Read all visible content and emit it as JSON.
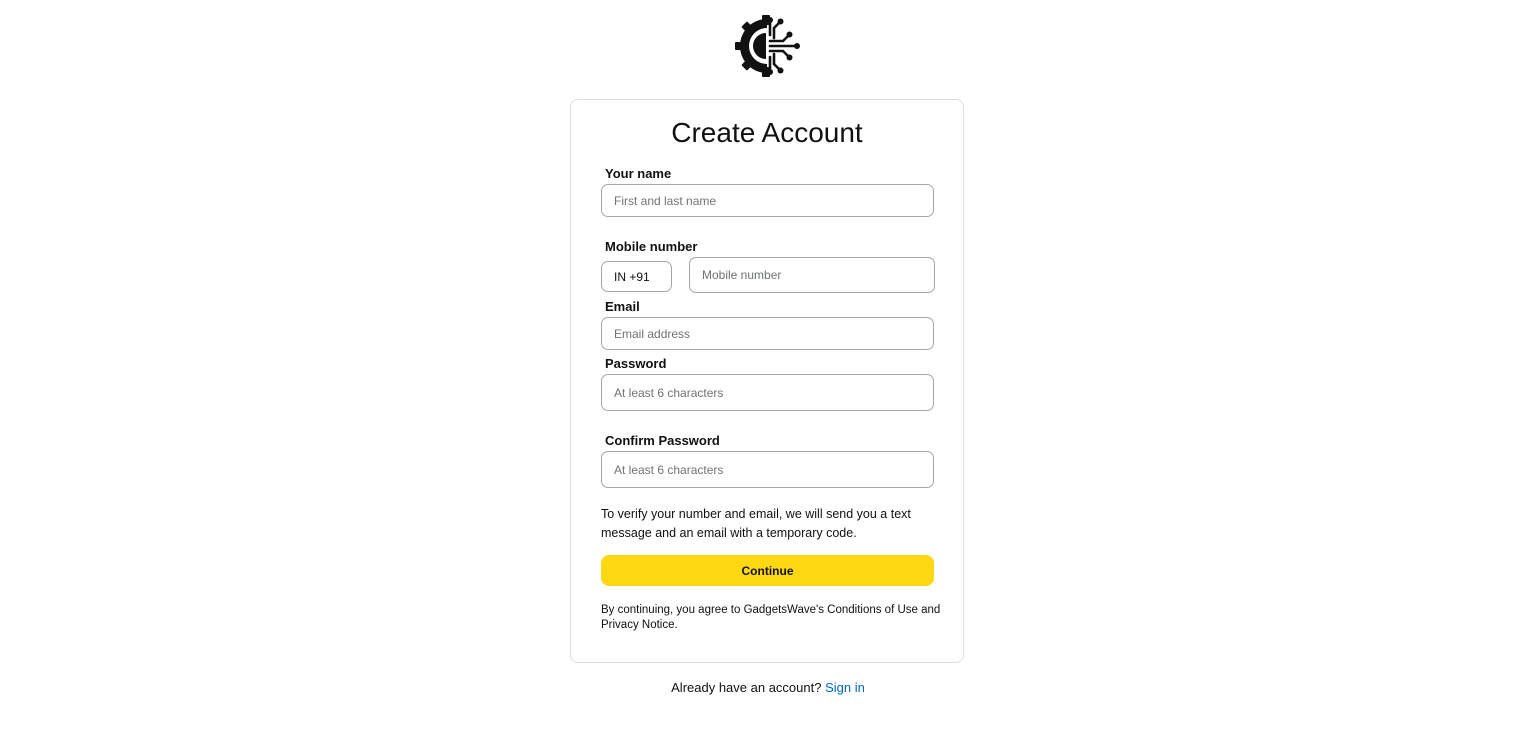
{
  "brand": {
    "logo_icon": "gear-circuit-logo-icon"
  },
  "form": {
    "title": "Create Account",
    "name": {
      "label": "Your name",
      "placeholder": "First and last name",
      "value": ""
    },
    "mobile": {
      "label": "Mobile number",
      "country_code": "IN +91",
      "placeholder": "Mobile number",
      "value": ""
    },
    "email": {
      "label": "Email",
      "placeholder": "Email address",
      "value": ""
    },
    "password": {
      "label": "Password",
      "placeholder": "At least 6 characters",
      "value": ""
    },
    "confirm_password": {
      "label": "Confirm Password",
      "placeholder": "At least 6 characters",
      "value": ""
    },
    "verify_text": "To verify your number and email, we will send you a text message and an email with a temporary code.",
    "continue_label": "Continue",
    "legal_text": "By continuing, you agree to GadgetsWave's Conditions of Use and Privacy Notice."
  },
  "footer": {
    "prompt": "Already have an account?",
    "signin_label": "Sign in"
  },
  "colors": {
    "accent_button": "#ffd814",
    "link": "#0066c0",
    "border": "#a6a6a6"
  }
}
